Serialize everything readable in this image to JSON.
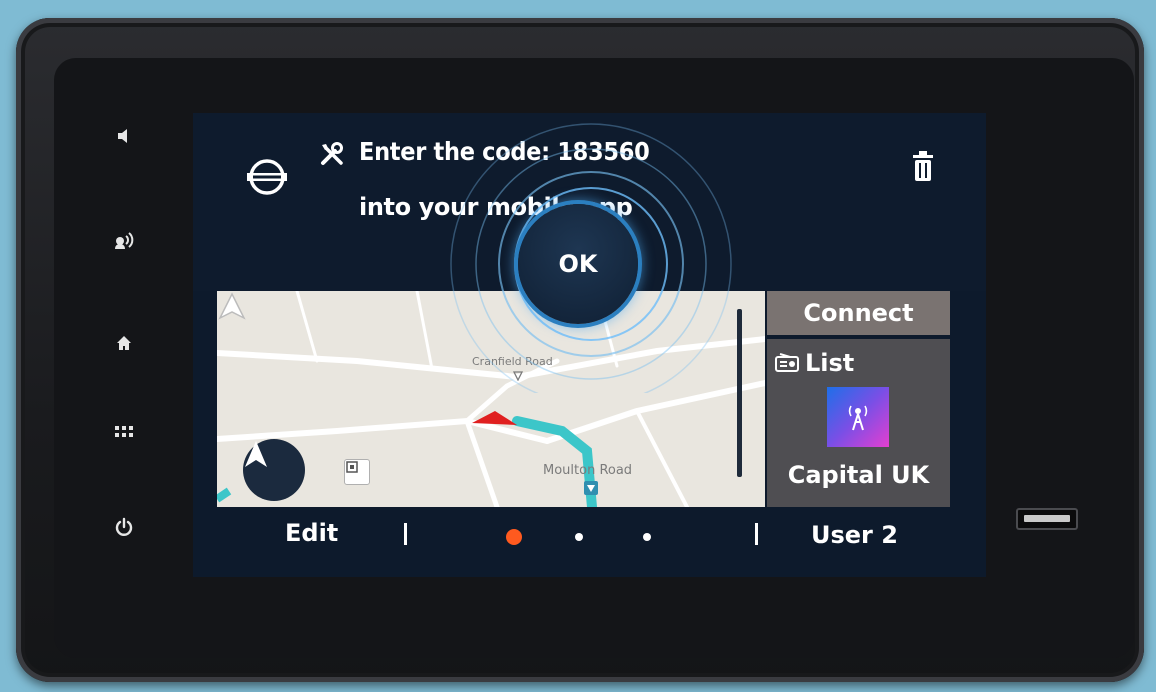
{
  "hardware": {
    "buttons": [
      "volume-mute",
      "voice-assist",
      "home",
      "apps-menu",
      "power"
    ]
  },
  "notification": {
    "line1": "Enter the code: 183560",
    "line2": "into your mobile app",
    "ok_label": "OK"
  },
  "map": {
    "street_1": "Cranfield Road",
    "street_2": "Moulton Road"
  },
  "widgets": {
    "connect_label": "Connect",
    "radio_list_label": "List",
    "station_name": "Capital UK"
  },
  "bottom_bar": {
    "edit_label": "Edit",
    "user_label": "User 2",
    "page_count": 3,
    "active_page": 1
  },
  "colors": {
    "screen_bg": "#0d1a2c",
    "ok_ring": "#2b7fc0",
    "route": "#3cc6c9",
    "active_dot": "#ff5a1f",
    "vehicle_marker": "#e02020"
  }
}
